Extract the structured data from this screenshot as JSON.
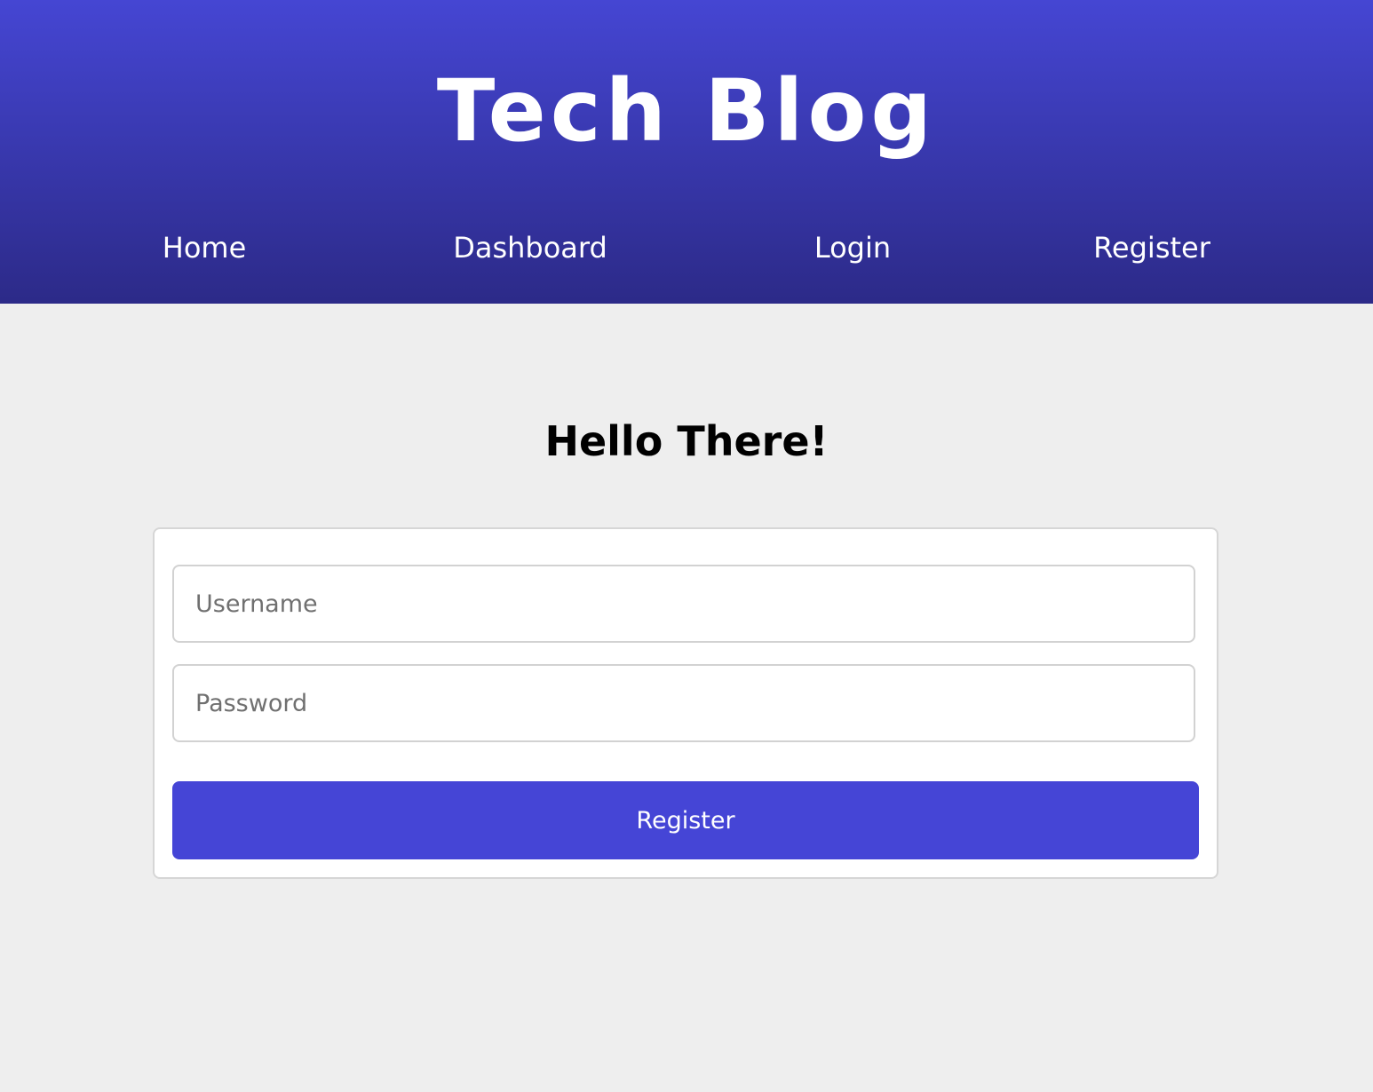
{
  "header": {
    "title": "Tech Blog",
    "gradient_top": "#4546d3",
    "gradient_bottom": "#2c2a88"
  },
  "nav": {
    "items": [
      {
        "label": "Home"
      },
      {
        "label": "Dashboard"
      },
      {
        "label": "Login"
      },
      {
        "label": "Register"
      }
    ]
  },
  "main": {
    "heading": "Hello There!"
  },
  "form": {
    "username_placeholder": "Username",
    "password_placeholder": "Password",
    "submit_label": "Register",
    "accent_color": "#4545d6"
  }
}
